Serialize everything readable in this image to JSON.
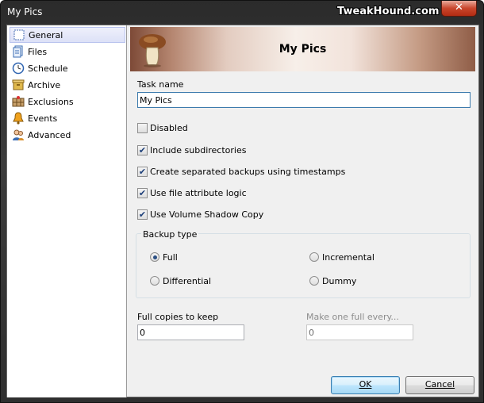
{
  "window": {
    "title": "My Pics",
    "watermark": "TweakHound.com",
    "close_glyph": "✕"
  },
  "sidebar": {
    "items": [
      {
        "label": "General",
        "icon": "general-icon",
        "selected": true
      },
      {
        "label": "Files",
        "icon": "files-icon"
      },
      {
        "label": "Schedule",
        "icon": "clock-icon"
      },
      {
        "label": "Archive",
        "icon": "archive-icon"
      },
      {
        "label": "Exclusions",
        "icon": "exclusions-icon"
      },
      {
        "label": "Events",
        "icon": "bell-icon"
      },
      {
        "label": "Advanced",
        "icon": "users-icon"
      }
    ]
  },
  "banner": {
    "title": "My Pics",
    "icon": "mushroom-icon"
  },
  "form": {
    "task_name_label": "Task name",
    "task_name_value": "My Pics",
    "checkboxes": [
      {
        "label": "Disabled",
        "checked": false
      },
      {
        "label": "Include subdirectories",
        "checked": true
      },
      {
        "label": "Create separated backups using timestamps",
        "checked": true
      },
      {
        "label": "Use file attribute logic",
        "checked": true
      },
      {
        "label": "Use Volume Shadow Copy",
        "checked": true
      }
    ],
    "backup_type_label": "Backup type",
    "backup_types": [
      {
        "label": "Full",
        "checked": true
      },
      {
        "label": "Incremental",
        "checked": false
      },
      {
        "label": "Differential",
        "checked": false
      },
      {
        "label": "Dummy",
        "checked": false
      }
    ],
    "full_copies_label": "Full copies to keep",
    "full_copies_value": "0",
    "make_full_label": "Make one full every...",
    "make_full_value": "0"
  },
  "buttons": {
    "ok": "OK",
    "cancel": "Cancel"
  },
  "colors": {
    "titlebar": "#2f2f2f",
    "close_button": "#c9462c",
    "selected_item": "#dde1f7",
    "default_button_border": "#3c7fb1"
  }
}
